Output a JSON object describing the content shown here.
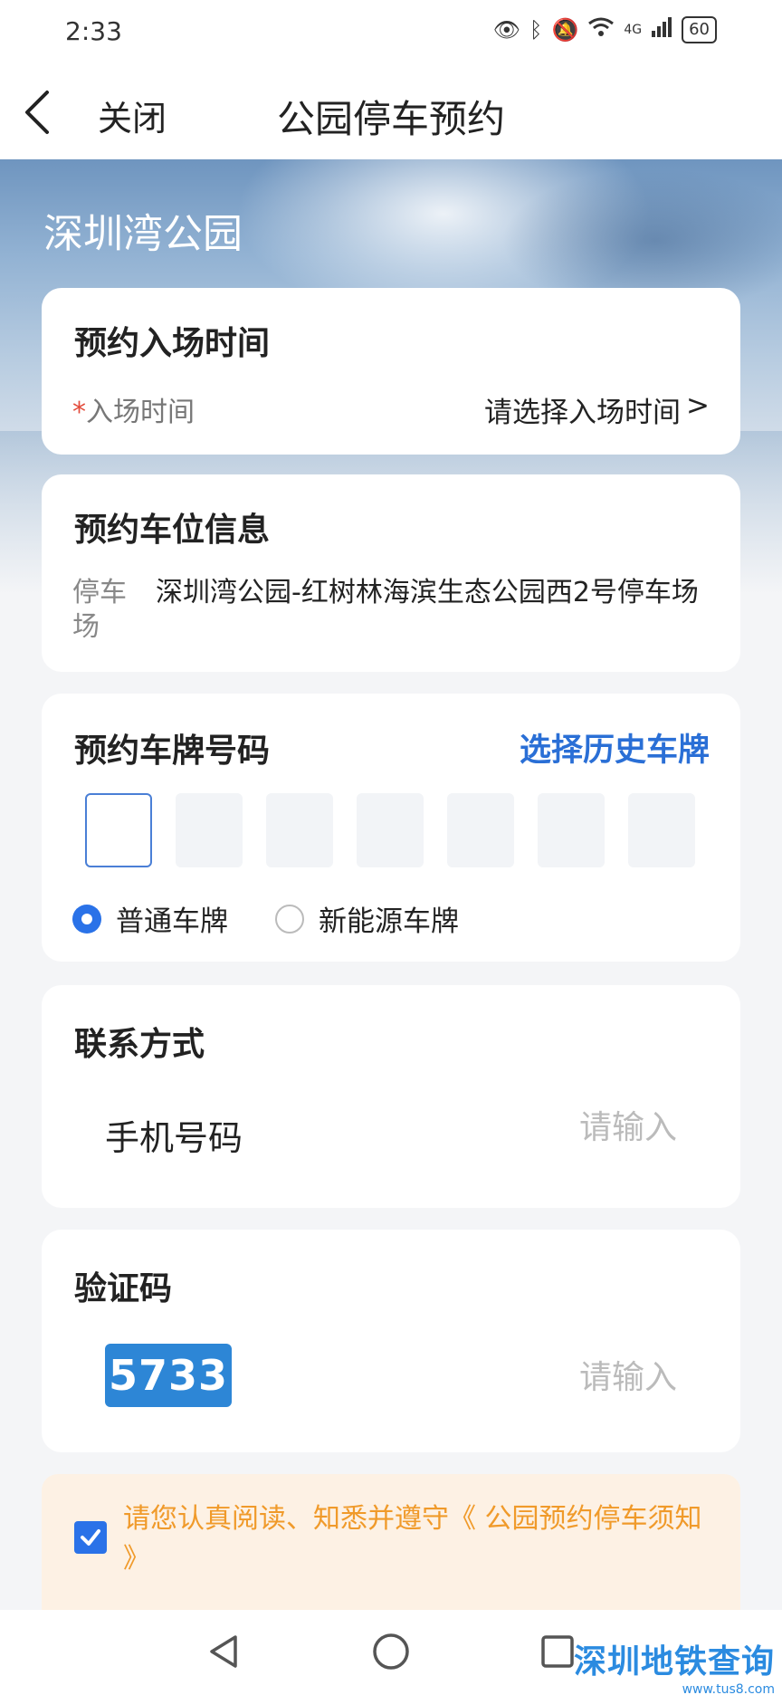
{
  "status_bar": {
    "time": "2:33",
    "network": "4G",
    "battery": "60"
  },
  "nav": {
    "close_label": "关闭",
    "title": "公园停车预约"
  },
  "park": {
    "name": "深圳湾公园"
  },
  "entry_time": {
    "title": "预约入场时间",
    "required_mark": "*",
    "label": "入场时间",
    "value": "请选择入场时间",
    "chevron": ">"
  },
  "parking_spot": {
    "title": "预约车位信息",
    "lot_label": "停车场",
    "lot_value": "深圳湾公园-红树林海滨生态公园西2号停车场"
  },
  "plate": {
    "title": "预约车牌号码",
    "history_link": "选择历史车牌",
    "box_count": 7,
    "types": [
      {
        "label": "普通车牌",
        "checked": true
      },
      {
        "label": "新能源车牌",
        "checked": false
      }
    ]
  },
  "contact": {
    "title": "联系方式",
    "phone_label": "手机号码",
    "phone_placeholder": "请输入"
  },
  "verification": {
    "title": "验证码",
    "captcha": "5733",
    "placeholder": "请输入"
  },
  "notice": {
    "text": "请您认真阅读、知悉并遵守《 公园预约停车须知 》",
    "checked": true
  },
  "watermark": {
    "title": "深圳地铁查询",
    "url": "www.tus8.com"
  },
  "colors": {
    "accent_blue": "#2a72e8",
    "link_blue": "#2a6fd6",
    "notice_orange": "#f09a2a",
    "notice_bg": "#fdf1e4",
    "required_red": "#e24b3b"
  }
}
